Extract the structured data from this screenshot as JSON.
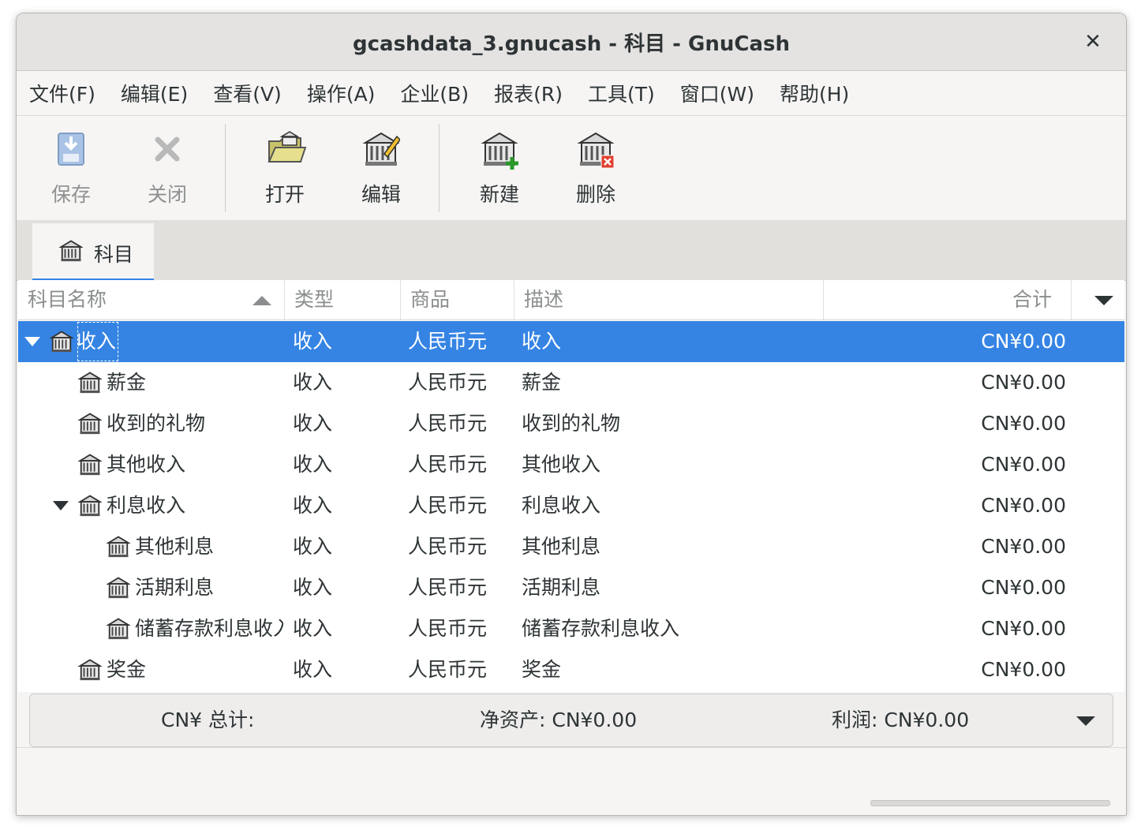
{
  "window": {
    "title": "gcashdata_3.gnucash - 科目 - GnuCash",
    "close_glyph": "✕"
  },
  "menu": [
    "文件(F)",
    "编辑(E)",
    "查看(V)",
    "操作(A)",
    "企业(B)",
    "报表(R)",
    "工具(T)",
    "窗口(W)",
    "帮助(H)"
  ],
  "toolbar": {
    "save": "保存",
    "close": "关闭",
    "open": "打开",
    "edit": "编辑",
    "new": "新建",
    "delete": "删除"
  },
  "tab": {
    "label": "科目",
    "icon": "account-icon"
  },
  "columns": {
    "name": "科目名称",
    "type": "类型",
    "commodity": "商品",
    "description": "描述",
    "total": "合计"
  },
  "rows": [
    {
      "name": "收入",
      "type": "收入",
      "commodity": "人民币元",
      "description": "收入",
      "total": "CN¥0.00"
    },
    {
      "name": "薪金",
      "type": "收入",
      "commodity": "人民币元",
      "description": "薪金",
      "total": "CN¥0.00"
    },
    {
      "name": "收到的礼物",
      "type": "收入",
      "commodity": "人民币元",
      "description": "收到的礼物",
      "total": "CN¥0.00"
    },
    {
      "name": "其他收入",
      "type": "收入",
      "commodity": "人民币元",
      "description": "其他收入",
      "total": "CN¥0.00"
    },
    {
      "name": "利息收入",
      "type": "收入",
      "commodity": "人民币元",
      "description": "利息收入",
      "total": "CN¥0.00"
    },
    {
      "name": "其他利息",
      "type": "收入",
      "commodity": "人民币元",
      "description": "其他利息",
      "total": "CN¥0.00"
    },
    {
      "name": "活期利息",
      "type": "收入",
      "commodity": "人民币元",
      "description": "活期利息",
      "total": "CN¥0.00"
    },
    {
      "name": "储蓄存款利息收入",
      "type": "收入",
      "commodity": "人民币元",
      "description": "储蓄存款利息收入",
      "total": "CN¥0.00"
    },
    {
      "name": "奖金",
      "type": "收入",
      "commodity": "人民币元",
      "description": "奖金",
      "total": "CN¥0.00"
    }
  ],
  "summary": {
    "total_label": "CN¥ 总计:",
    "net_assets": "净资产:  CN¥0.00",
    "profit": "利润:  CN¥0.00"
  }
}
